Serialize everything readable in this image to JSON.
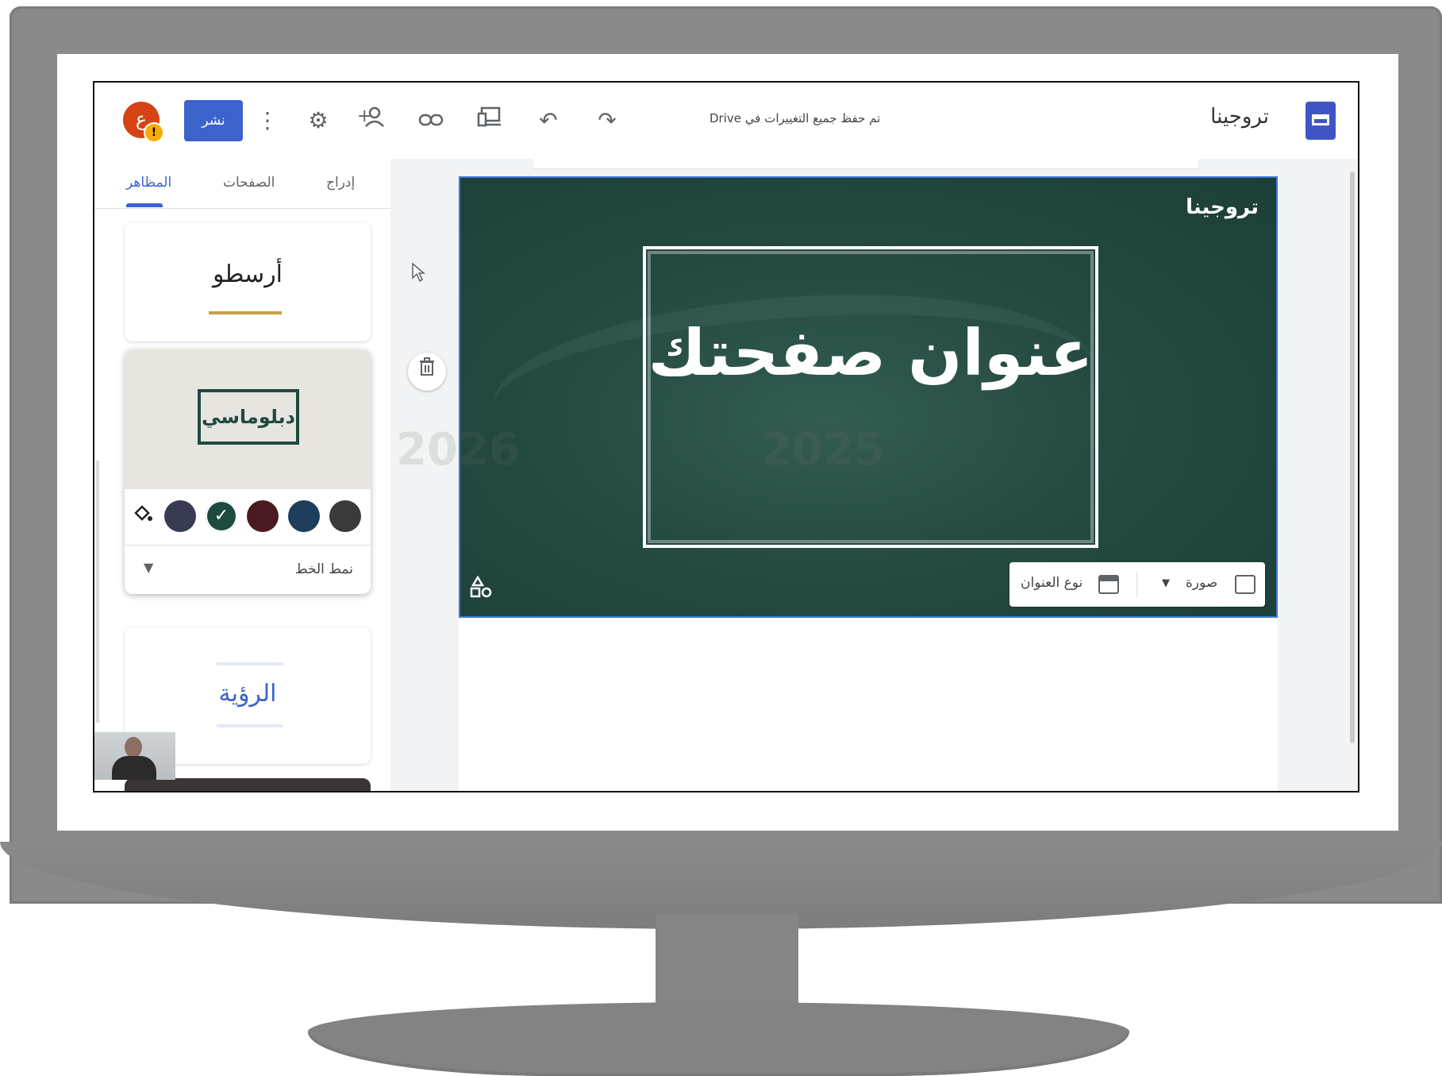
{
  "topbar": {
    "avatar_letter": "ع",
    "avatar_badge": "!",
    "publish_label": "نشر",
    "saved_status": "تم حفظ جميع التغييرات في Drive",
    "site_title": "تروجينا",
    "icons": [
      "more-vert-icon",
      "gear-icon",
      "share-person-icon",
      "link-icon",
      "devices-preview-icon",
      "undo-icon",
      "redo-icon",
      "google-sites-logo"
    ]
  },
  "sidebar": {
    "tabs": [
      {
        "label": "المظاهر",
        "active": true
      },
      {
        "label": "الصفحات",
        "active": false
      },
      {
        "label": "إدراج",
        "active": false
      }
    ],
    "themes": [
      {
        "name": "أرسطو"
      },
      {
        "name": "دبلوماسي",
        "selected": true,
        "swatches": [
          "#383b52",
          "#1e4a40",
          "#4a1a22",
          "#1d3d5a",
          "#3a3a3a"
        ],
        "selected_swatch": 1,
        "font_style_label": "نمط الخط"
      },
      {
        "name": "الرؤية"
      }
    ]
  },
  "hero": {
    "site_name": "تروجينا",
    "title": "عنوان صفحتك",
    "toolbar": {
      "image_label": "صورة",
      "title_type_label": "نوع العنوان"
    }
  },
  "colors": {
    "accent": "#3c63cc",
    "hero_bg": "#244a42",
    "avatar": "#d84315"
  }
}
